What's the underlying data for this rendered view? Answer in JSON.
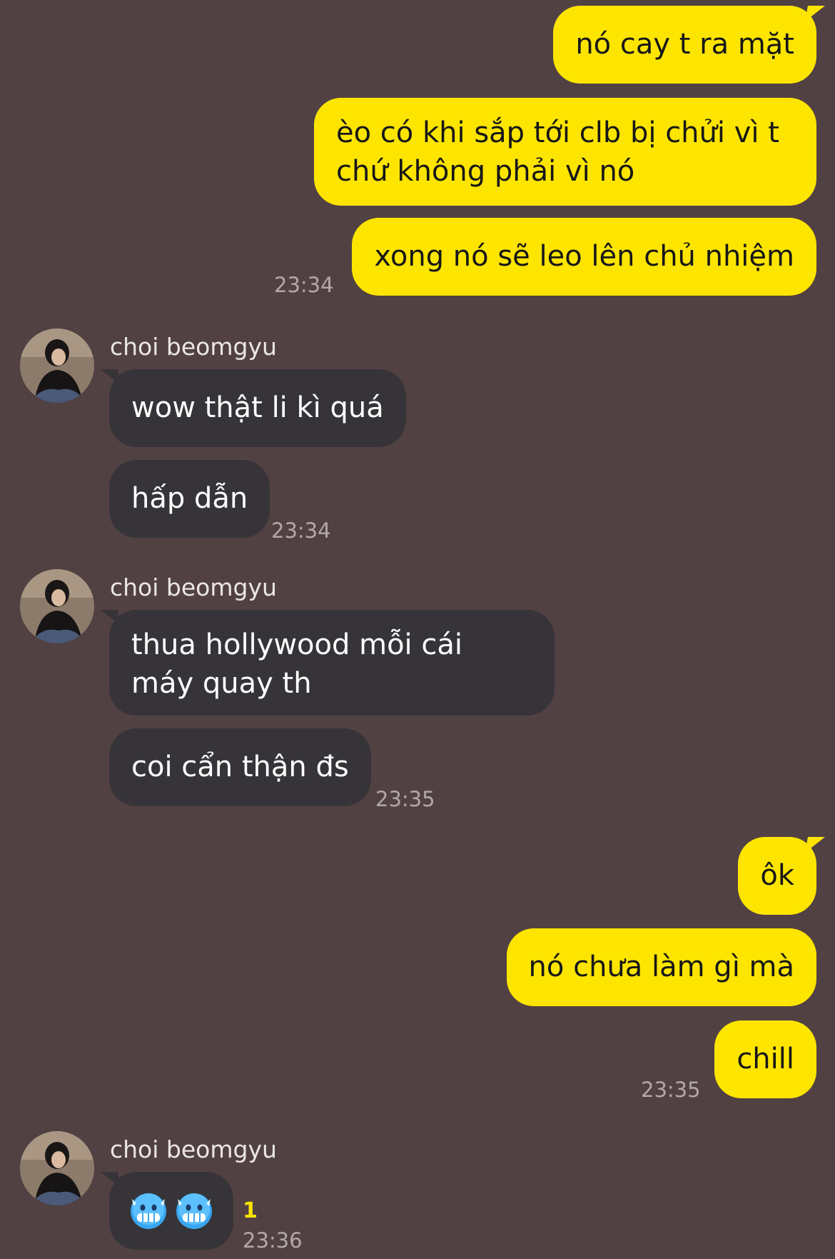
{
  "conversation": {
    "groups": [
      {
        "sender": "me",
        "messages": [
          "nó cay t ra mặt",
          "èo có khi sắp tới clb bị chửi vì t chứ không phải vì nó",
          "xong nó sẽ leo lên chủ nhiệm"
        ],
        "time": "23:34"
      },
      {
        "sender": "choi beomgyu",
        "messages": [
          "wow thật li kì quá",
          "hấp dẫn"
        ],
        "time": "23:34"
      },
      {
        "sender": "choi beomgyu",
        "messages": [
          "thua hollywood mỗi cái máy quay th",
          "coi cẩn thận đs"
        ],
        "time": "23:35"
      },
      {
        "sender": "me",
        "messages": [
          "ôk",
          "nó chưa làm gì mà",
          "chill"
        ],
        "time": "23:35"
      },
      {
        "sender": "choi beomgyu",
        "messages": [
          "🥶🥶"
        ],
        "emoji_names": [
          "cold-face-emoji",
          "cold-face-emoji"
        ],
        "unread_count": "1",
        "time": "23:36"
      }
    ]
  },
  "colors": {
    "background": "#524143",
    "my_bubble": "#fee500",
    "their_bubble": "#363438",
    "unread": "#fee500"
  }
}
